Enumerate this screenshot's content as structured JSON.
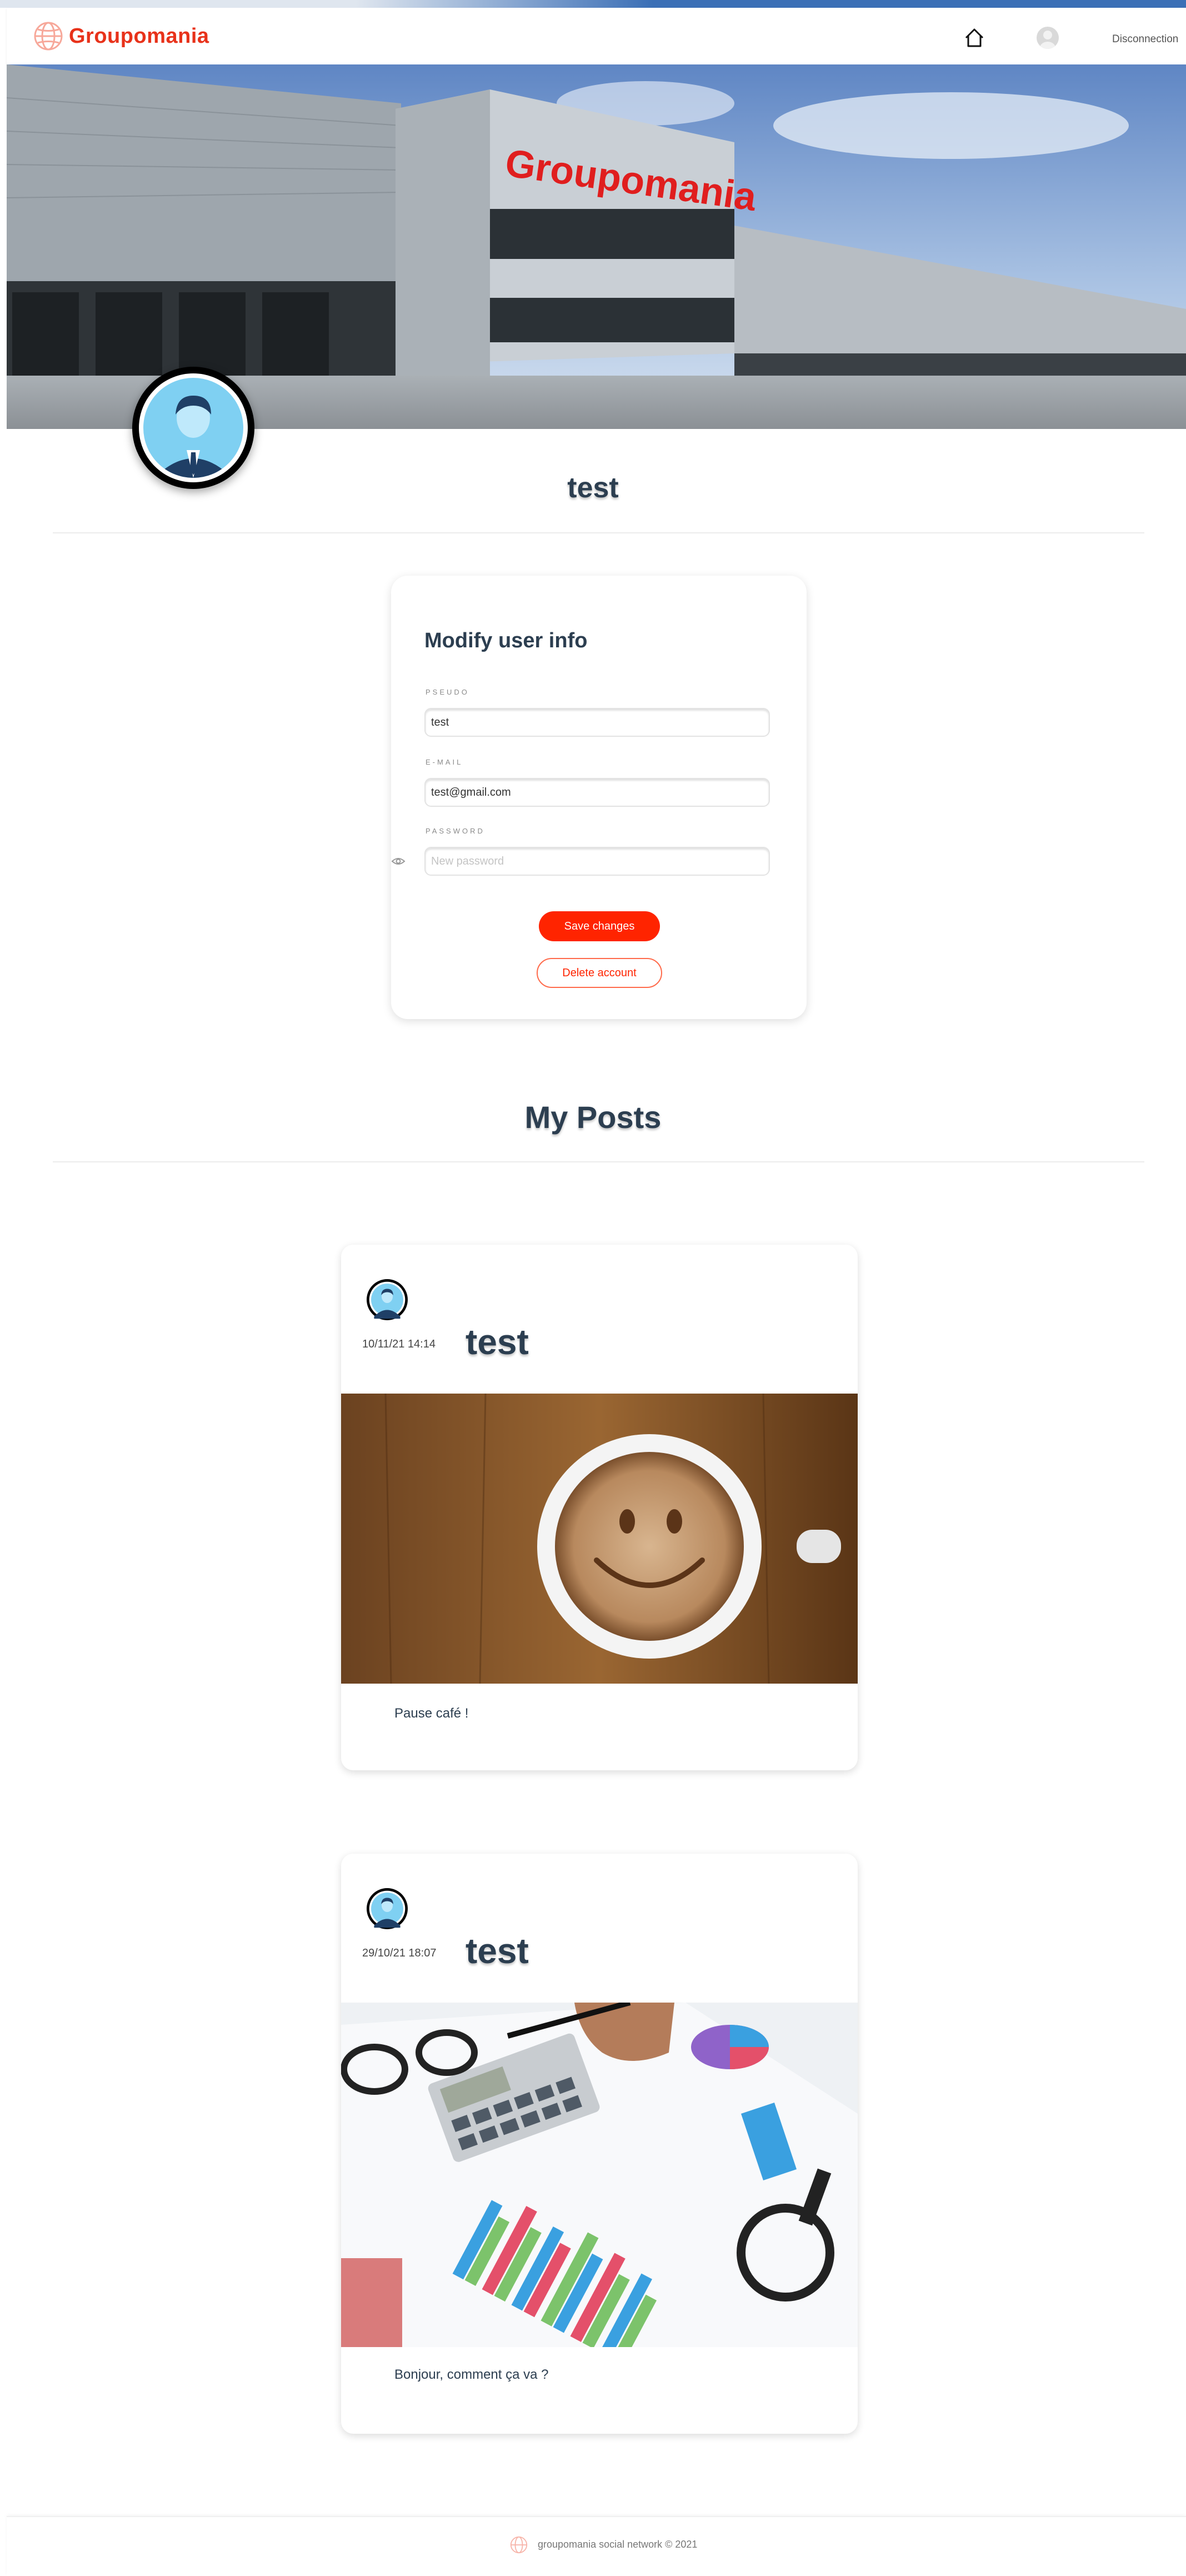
{
  "brand": {
    "name": "Groupomania",
    "color": "#e8321a"
  },
  "nav": {
    "home_icon": "home-icon",
    "avatar_icon": "user-avatar-icon",
    "logout_label": "Disconnection"
  },
  "banner": {
    "sign_text": "Groupomania"
  },
  "profile": {
    "name": "test"
  },
  "form": {
    "title": "Modify user info",
    "pseudo_label": "PSEUDO",
    "pseudo_value": "test",
    "email_label": "E-MAIL",
    "email_value": "test@gmail.com",
    "password_label": "PASSWORD",
    "password_placeholder": "New password",
    "save_label": "Save changes",
    "delete_label": "Delete account",
    "accent_color": "#ff2400"
  },
  "posts_section": {
    "title": "My Posts"
  },
  "posts": [
    {
      "author": "test",
      "date": "10/11/21 14:14",
      "text": "Pause café !",
      "image": "coffee-smiley"
    },
    {
      "author": "test",
      "date": "29/10/21 18:07",
      "text": "Bonjour, comment ça va ?",
      "image": "calculator-charts"
    }
  ],
  "footer": {
    "text": "groupomania social network © 2021"
  }
}
